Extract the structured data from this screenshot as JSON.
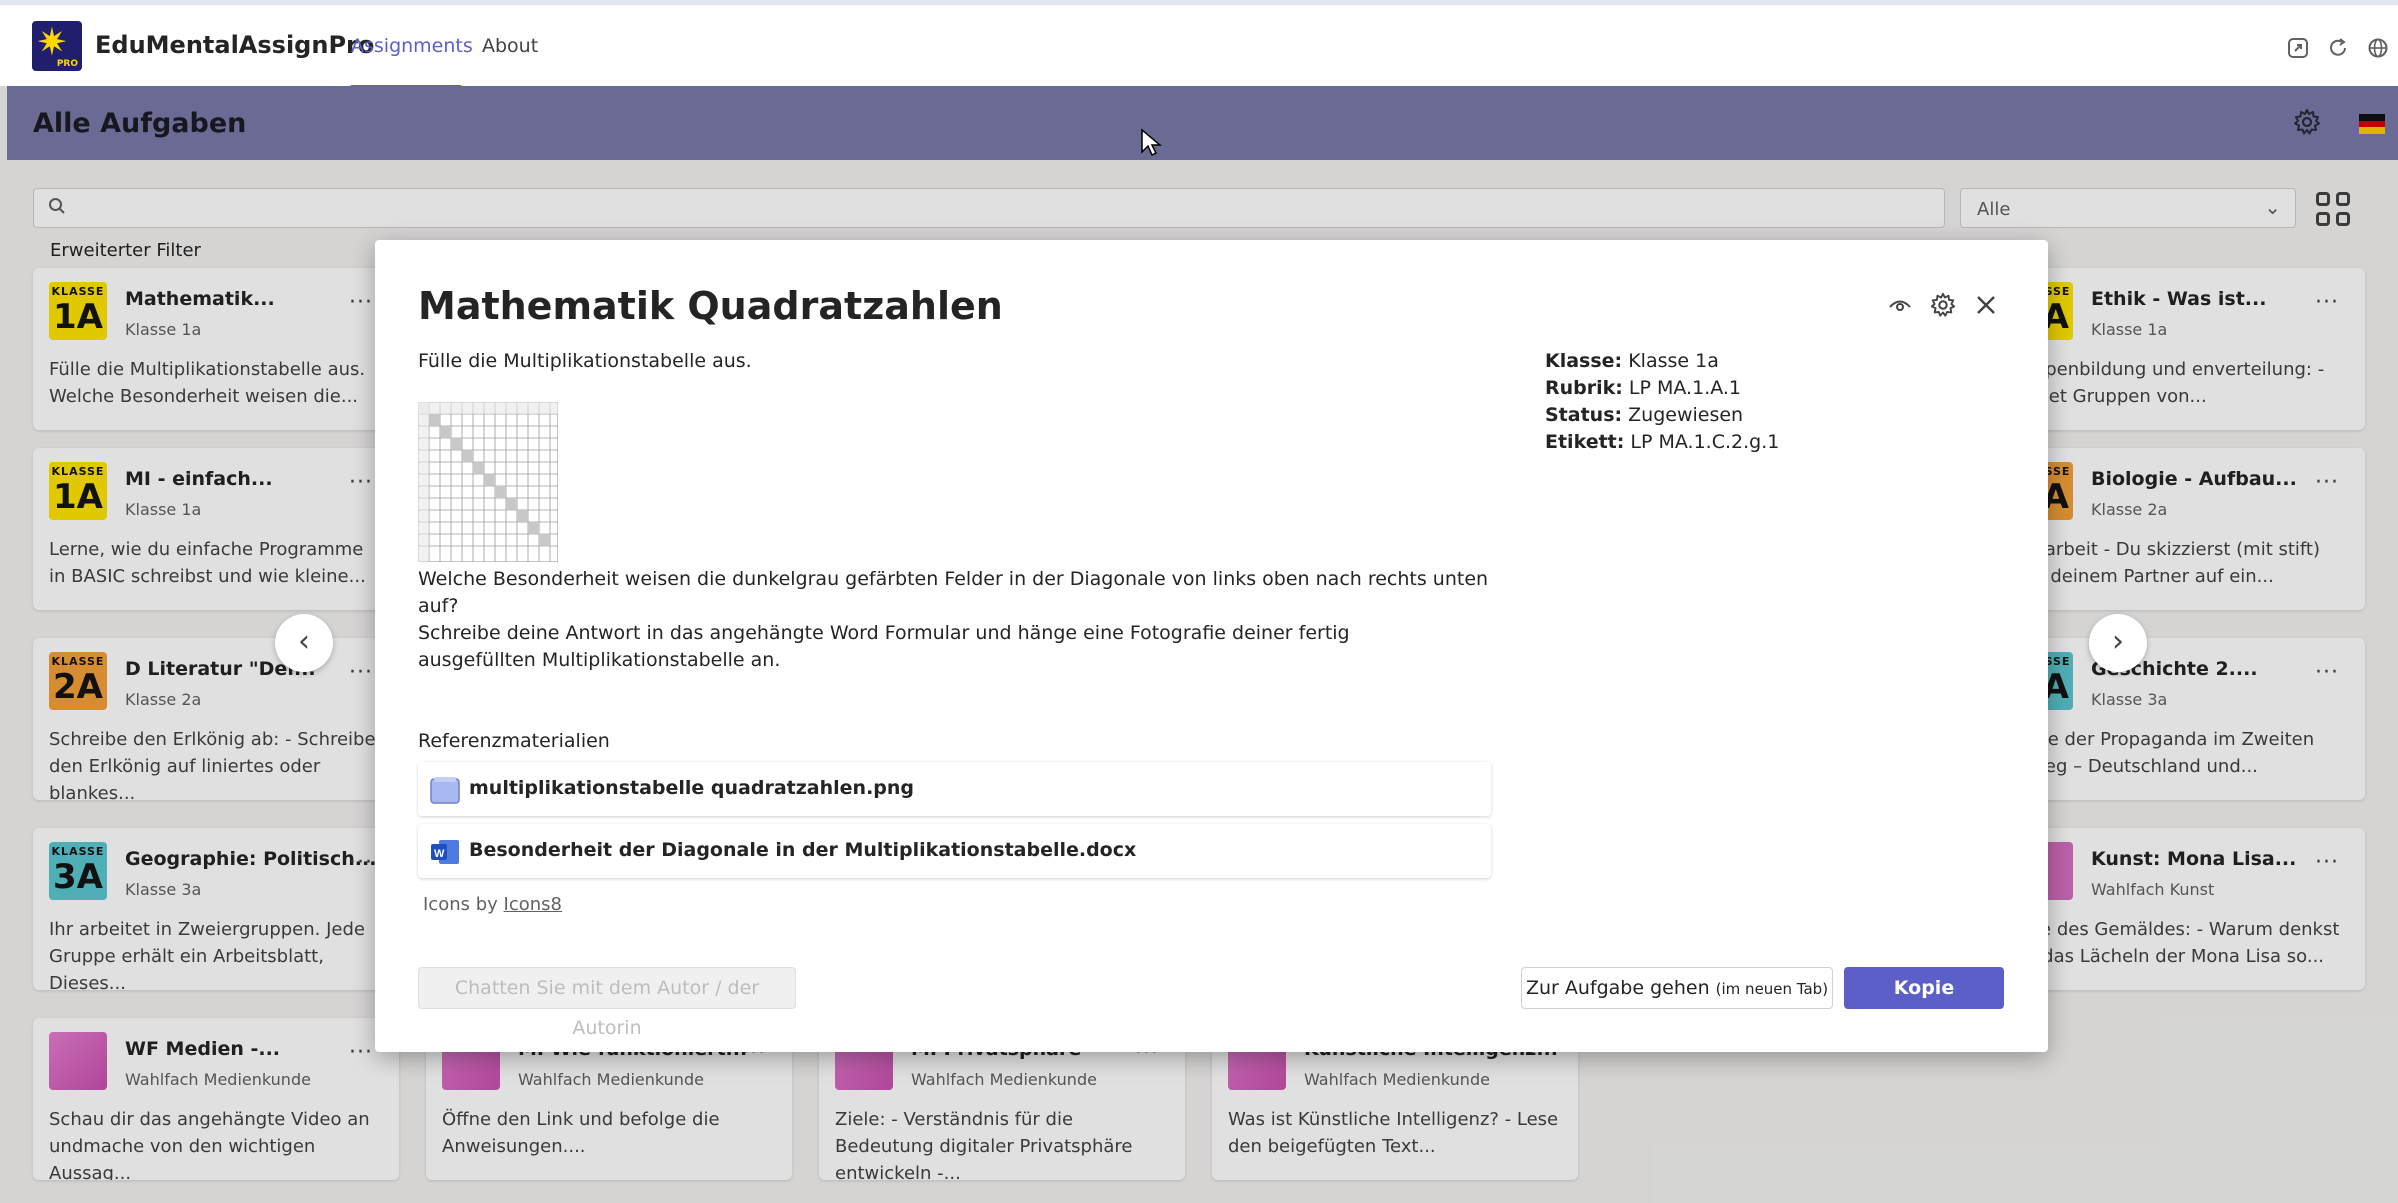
{
  "app": {
    "title": "EduMentalAssignPro",
    "logo_badge": "PRO",
    "tabs": [
      {
        "label": "Assignments",
        "active": true
      },
      {
        "label": "About",
        "active": false
      }
    ],
    "window_icons": [
      "popout-icon",
      "refresh-icon",
      "globe-icon"
    ]
  },
  "header": {
    "title": "Alle Aufgaben",
    "flag": "germany-flag"
  },
  "filters": {
    "search_placeholder": "",
    "select_value": "Alle",
    "advanced_label": "Erweiterter Filter"
  },
  "cards": [
    {
      "badge_k": "KLASSE",
      "badge_n": "1A",
      "badge_color": "#ffe500",
      "title": "Mathematik...",
      "sub": "Klasse 1a",
      "desc": "Fülle die Multiplikationstabelle aus. Welche Besonderheit weisen die..."
    },
    {
      "badge_k": "KLASSE",
      "badge_n": "1A",
      "badge_color": "#ffe500",
      "title": "MI - einfach...",
      "sub": "Klasse 1a",
      "desc": "Lerne, wie du einfache Programme in BASIC schreibst und wie kleine..."
    },
    {
      "badge_k": "KLASSE",
      "badge_n": "2A",
      "badge_color": "#f4a13a",
      "title": "D Literatur \"Der...",
      "sub": "Klasse 2a",
      "desc": "Schreibe den Erlkönig ab: - Schreibe den Erlkönig auf liniertes oder blankes..."
    },
    {
      "badge_k": "KLASSE",
      "badge_n": "3A",
      "badge_color": "#5cc6d0",
      "title": "Geographie: Politisch...",
      "sub": "Klasse 3a",
      "desc": "Ihr arbeitet in Zweiergruppen. Jede Gruppe erhält ein Arbeitsblatt, Dieses..."
    },
    {
      "badge_k": "",
      "badge_n": "",
      "badge_color": "#d66fc0",
      "title": "WF Medien -...",
      "sub": "Wahlfach Medienkunde",
      "desc": "Schau dir das angehängte Video an undmache von den wichtigen Aussag..."
    },
    {
      "badge_k": "",
      "badge_n": "",
      "badge_color": "#d66fc0",
      "title": "MI Wie funktioniert...",
      "sub": "Wahlfach Medienkunde",
      "desc": "Öffne den Link und befolge die Anweisungen...."
    },
    {
      "badge_k": "",
      "badge_n": "",
      "badge_color": "#d66fc0",
      "title": "MI Privatsphäre",
      "sub": "Wahlfach Medienkunde",
      "desc": "Ziele: - Verständnis für die Bedeutung digitaler Privatsphäre entwickeln -..."
    },
    {
      "badge_k": "",
      "badge_n": "",
      "badge_color": "#d66fc0",
      "title": "Künstliche Intelligenz...",
      "sub": "Wahlfach Medienkunde",
      "desc": "Was ist Künstliche Intelligenz? - Lese den beigefügten Text..."
    },
    {
      "badge_k": "KLASSE",
      "badge_n": "1A",
      "badge_color": "#ffe500",
      "title": "Ethik - Was ist...",
      "sub": "Klasse 1a",
      "desc": "ruppenbildung und enverteilung: - Bildet Gruppen von..."
    },
    {
      "badge_k": "KLASSE",
      "badge_n": "2A",
      "badge_color": "#f4a13a",
      "title": "Biologie - Aufbau...",
      "sub": "Klasse 2a",
      "desc": "nerarbeit - Du skizzierst (mit stift) mit deinem Partner auf ein..."
    },
    {
      "badge_k": "KLASSE",
      "badge_n": "3A",
      "badge_color": "#5cc6d0",
      "title": "Geschichte 2....",
      "sub": "Klasse 3a",
      "desc": "Rolle der Propaganda im Zweiten tkrieg – Deutschland und..."
    },
    {
      "badge_k": "",
      "badge_n": "",
      "badge_color": "#d66fc0",
      "title": "Kunst: Mona Lisa...",
      "sub": "Wahlfach Kunst",
      "desc": "lyse des Gemäldes: - Warum denkst ist das Lächeln der Mona Lisa so..."
    }
  ],
  "dialog": {
    "title": "Mathematik Quadratzahlen",
    "intro": "Fülle die Multiplikationstabelle aus.",
    "question": "Welche Besonderheit weisen die dunkelgrau gefärbten Felder in der Diagonale von links oben nach rechts unten auf?",
    "instruction": "Schreibe deine Antwort in das angehängte Word Formular und hänge eine Fotografie deiner fertig ausgefüllten Multiplikationstabelle an.",
    "meta": [
      {
        "key": "Klasse:",
        "value": "Klasse 1a"
      },
      {
        "key": "Rubrik:",
        "value": "LP MA.1.A.1"
      },
      {
        "key": "Status:",
        "value": "Zugewiesen"
      },
      {
        "key": "Etikett:",
        "value": "LP MA.1.C.2.g.1"
      }
    ],
    "ref_label": "Referenzmaterialien",
    "files": [
      {
        "name": "multiplikationstabelle quadratzahlen.png",
        "icon": "image-file-icon"
      },
      {
        "name": "Besonderheit der Diagonale in der Multiplikationstabelle.docx",
        "icon": "word-file-icon"
      }
    ],
    "credits_prefix": "Icons by",
    "credits_link": "Icons8",
    "chat_button": "Chatten Sie mit dem Autor / der Autorin",
    "open_button": "Zur Aufgabe gehen",
    "open_button_hint": "(im neuen Tab)",
    "copy_button": "Kopie erstellen"
  },
  "colors": {
    "accent": "#5b5fc7",
    "header_band": "#7a79a9"
  }
}
